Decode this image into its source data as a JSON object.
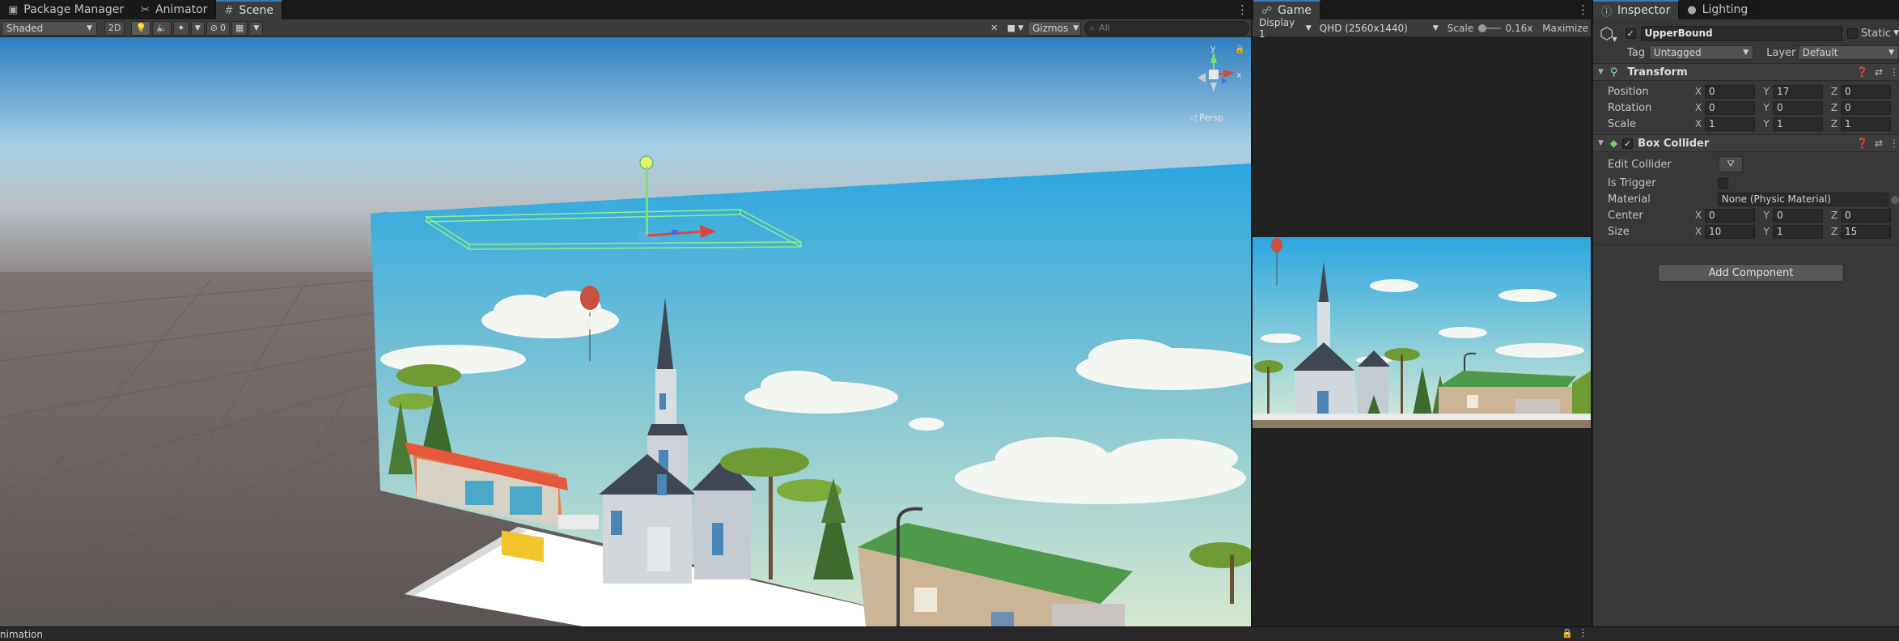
{
  "scene_tabs": [
    {
      "label": "Package Manager",
      "icon": "package-icon",
      "glyph": "▣"
    },
    {
      "label": "Animator",
      "icon": "animator-icon",
      "glyph": "✂"
    },
    {
      "label": "Scene",
      "icon": "scene-grid-icon",
      "glyph": "#"
    }
  ],
  "game_tabs": [
    {
      "label": "Game",
      "icon": "gamepad-icon",
      "glyph": "☍"
    }
  ],
  "inspector_tabs": [
    {
      "label": "Inspector",
      "icon": "info-icon",
      "glyph": "ⓘ"
    },
    {
      "label": "Lighting",
      "icon": "lightbulb-icon",
      "glyph": "●"
    }
  ],
  "scene_toolbar": {
    "shading_mode": "Shaded",
    "toggle_2d": "2D",
    "hidden_count": "0",
    "gizmos_label": "Gizmos",
    "search_placeholder": "All"
  },
  "scene_gizmo": {
    "y": "y",
    "x": "x",
    "persp_label": "◁ Persp"
  },
  "game_toolbar": {
    "display": "Display 1",
    "resolution": "QHD (2560x1440)",
    "scale_label": "Scale",
    "scale_value": "0.16x",
    "maximize": "Maximize"
  },
  "inspector": {
    "object_name": "UpperBound",
    "static_label": "Static",
    "tag_label": "Tag",
    "tag_value": "Untagged",
    "layer_label": "Layer",
    "layer_value": "Default",
    "transform": {
      "title": "Transform",
      "position": {
        "label": "Position",
        "x": "0",
        "y": "17",
        "z": "0"
      },
      "rotation": {
        "label": "Rotation",
        "x": "0",
        "y": "0",
        "z": "0"
      },
      "scale": {
        "label": "Scale",
        "x": "1",
        "y": "1",
        "z": "1"
      }
    },
    "box_collider": {
      "title": "Box Collider",
      "edit_collider_label": "Edit Collider",
      "is_trigger_label": "Is Trigger",
      "material_label": "Material",
      "material_value": "None (Physic Material)",
      "center": {
        "label": "Center",
        "x": "0",
        "y": "0",
        "z": "0"
      },
      "size": {
        "label": "Size",
        "x": "10",
        "y": "1",
        "z": "15"
      }
    },
    "add_component": "Add Component"
  },
  "axis_letters": {
    "x": "X",
    "y": "Y",
    "z": "Z"
  },
  "bottom": {
    "label": "nimation"
  },
  "colors": {
    "accent_blue": "#3a79bb",
    "sky_top": "#2aa6df",
    "sky_bottom": "#cfe6d8",
    "ground": "#6a6260",
    "collider_green": "#8df08d",
    "move_red": "#d9473a"
  }
}
